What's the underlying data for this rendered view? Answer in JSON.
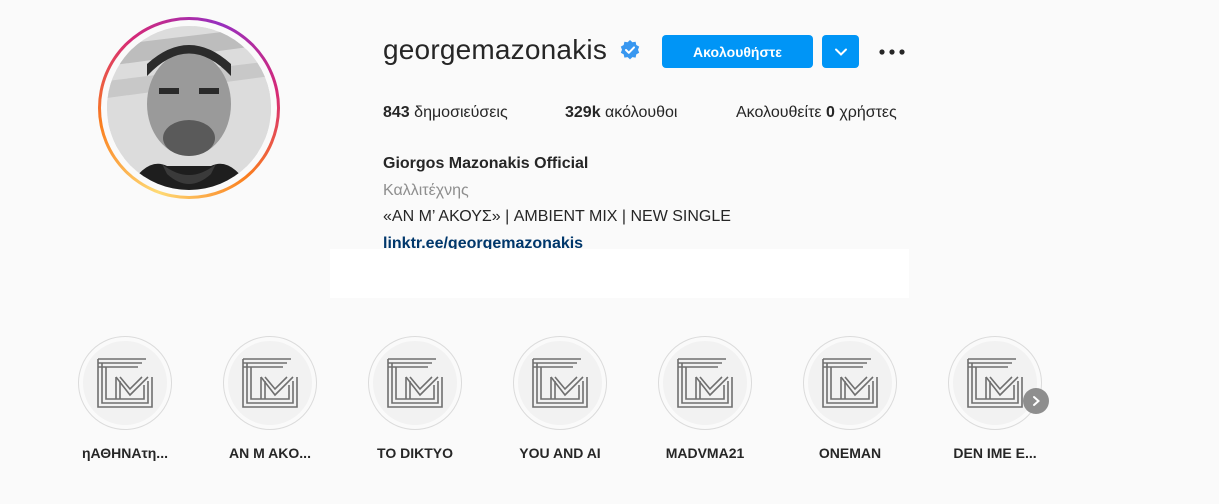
{
  "profile": {
    "username": "georgemazonakis",
    "follow_label": "Ακολουθήστε",
    "stats": {
      "posts_count": "843",
      "posts_label": "δημοσιεύσεις",
      "followers_count": "329k",
      "followers_label": "ακόλουθοι",
      "following_prefix": "Ακολουθείτε",
      "following_count": "0",
      "following_suffix": "χρήστες"
    },
    "bio": {
      "name": "Giorgos Mazonakis Official",
      "category": "Καλλιτέχνης",
      "text": "«ΑΝ Μ’ ΑΚΟΥΣ» | AMBIENT MIX | NEW SINGLE",
      "link": "linktr.ee/georgemazonakis"
    }
  },
  "highlights": [
    {
      "label": "ηΑΘΗΝΑτη..."
    },
    {
      "label": "AN M AKO..."
    },
    {
      "label": "TO DIKTYO"
    },
    {
      "label": "YOU AND AI"
    },
    {
      "label": "MADVMA21"
    },
    {
      "label": "ONEMAN"
    },
    {
      "label": "DEN IME E..."
    }
  ],
  "colors": {
    "accent": "#0095f6",
    "verified": "#3897f0",
    "link": "#00376b",
    "muted": "#8e8e8e"
  },
  "icons": {
    "verified": "verified-badge-icon",
    "dropdown": "chevron-down-icon",
    "more": "more-options-icon",
    "next": "chevron-right-icon"
  }
}
